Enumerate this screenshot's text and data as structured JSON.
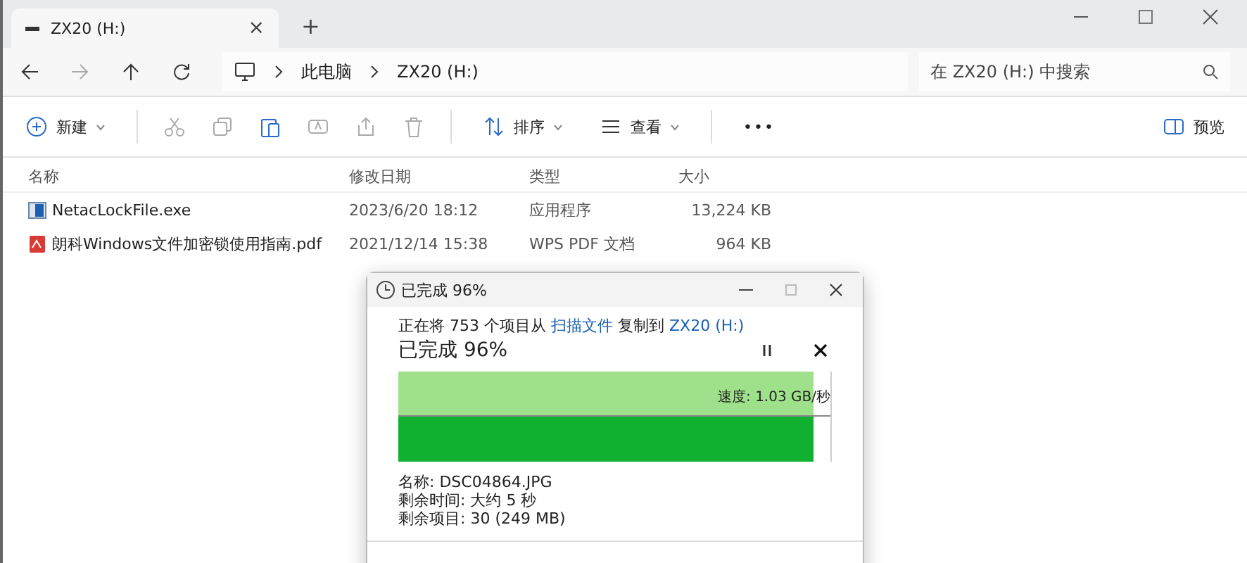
{
  "tab": {
    "title": "ZX20 (H:)",
    "close": "×",
    "new": "+"
  },
  "breadcrumb": [
    "此电脑",
    "ZX20 (H:)"
  ],
  "search": {
    "placeholder": "在 ZX20 (H:) 中搜索"
  },
  "toolbar": {
    "new": "新建",
    "sort": "排序",
    "view": "查看",
    "more": "•••",
    "preview": "预览"
  },
  "table": {
    "columns": [
      "名称",
      "修改日期",
      "类型",
      "大小"
    ],
    "rows": [
      {
        "kind": "exe",
        "name": "NetacLockFile.exe",
        "date": "2023/6/20 18:12",
        "type": "应用程序",
        "size": "13,224 KB"
      },
      {
        "kind": "pdf",
        "name": "朗科Windows文件加密锁使用指南.pdf",
        "date": "2021/12/14 15:38",
        "type": "WPS PDF 文档",
        "size": "964 KB"
      }
    ]
  },
  "dialog": {
    "title": "已完成 96%",
    "source_prefix": "正在将 753 个项目从",
    "source": "扫描文件",
    "dest_prefix": "复制到",
    "dest": "ZX20 (H:)",
    "progress_text": "已完成 96%",
    "level": 0.96,
    "speed": "速度: 1.03 GB/秒",
    "details": [
      "名称: DSC04864.JPG",
      "剩余时间: 大约 5 秒",
      "剩余项目: 30 (249 MB)"
    ]
  }
}
